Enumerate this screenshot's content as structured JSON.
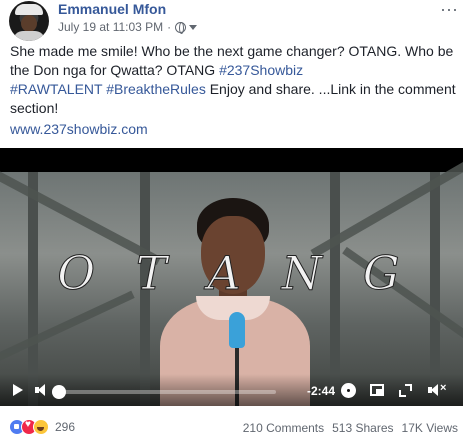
{
  "post": {
    "author": "Emmanuel Mfon",
    "timestamp": "July 19 at 11:03 PM",
    "separator": "·",
    "privacy_icon": "globe-icon",
    "more_label": "···",
    "paragraph1": "She made me smile! Who be the next game changer? OTANG. Who be the Don nga for Qwatta? OTANG ",
    "paragraph1_tag": "#237Showbiz",
    "paragraph2_tags": "#RAWTALENT #BreaktheRules",
    "paragraph2_rest": " Enjoy and share. ...Link in the comment section!",
    "link": "www.237showbiz.com"
  },
  "video": {
    "overlay_title": [
      "O",
      "T",
      "A",
      "N",
      "G"
    ],
    "time_remaining": "-2:44",
    "progress": 0.03,
    "colors": {
      "progress": "#4267b2"
    }
  },
  "footer": {
    "reaction_icons": [
      "like-icon",
      "love-icon",
      "haha-icon"
    ],
    "reaction_count": "296",
    "comments": "210 Comments",
    "shares": "513 Shares",
    "views": "17K Views"
  },
  "colors": {
    "link": "#365899",
    "meta": "#616770"
  }
}
